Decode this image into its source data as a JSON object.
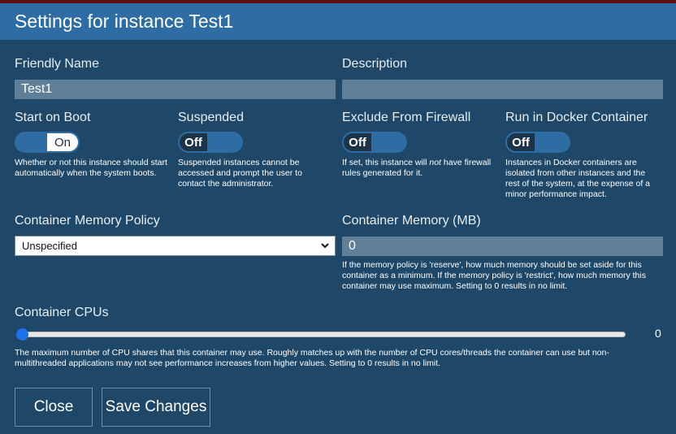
{
  "dialog": {
    "title": "Settings for instance Test1"
  },
  "friendly_name": {
    "label": "Friendly Name",
    "value": "Test1"
  },
  "description": {
    "label": "Description",
    "value": ""
  },
  "start_on_boot": {
    "label": "Start on Boot",
    "state": "On",
    "help": "Whether or not this instance should start automatically when the system boots."
  },
  "suspended": {
    "label": "Suspended",
    "state": "Off",
    "help": "Suspended instances cannot be accessed and prompt the user to contact the administrator."
  },
  "exclude_firewall": {
    "label": "Exclude From Firewall",
    "state": "Off",
    "help_pre": "If set, this instance will ",
    "help_em": "not",
    "help_post": " have firewall rules generated for it."
  },
  "docker": {
    "label": "Run in Docker Container",
    "state": "Off",
    "help": "Instances in Docker containers are isolated from other instances and the rest of the system, at the expense of a minor performance impact."
  },
  "memory_policy": {
    "label": "Container Memory Policy",
    "selected": "Unspecified"
  },
  "container_memory": {
    "label": "Container Memory (MB)",
    "value": "0",
    "help": "If the memory policy is 'reserve', how much memory should be set aside for this container as a minimum. If the memory policy is 'restrict', how much memory this container may use maximum. Setting to 0 results in no limit."
  },
  "container_cpus": {
    "label": "Container CPUs",
    "value": "0",
    "help": "The maximum number of CPU shares that this container may use. Roughly matches up with the number of CPU cores/threads the container can use but non-multithreaded applications may not see performance increases from higher values. Setting to 0 results in no limit."
  },
  "buttons": {
    "close": "Close",
    "save": "Save Changes"
  },
  "colors": {
    "title_bar": "#2d6da4",
    "dialog_bg": "#1f4868",
    "toggle_track": "#2d6da4",
    "input_bg": "#5f7f99"
  }
}
